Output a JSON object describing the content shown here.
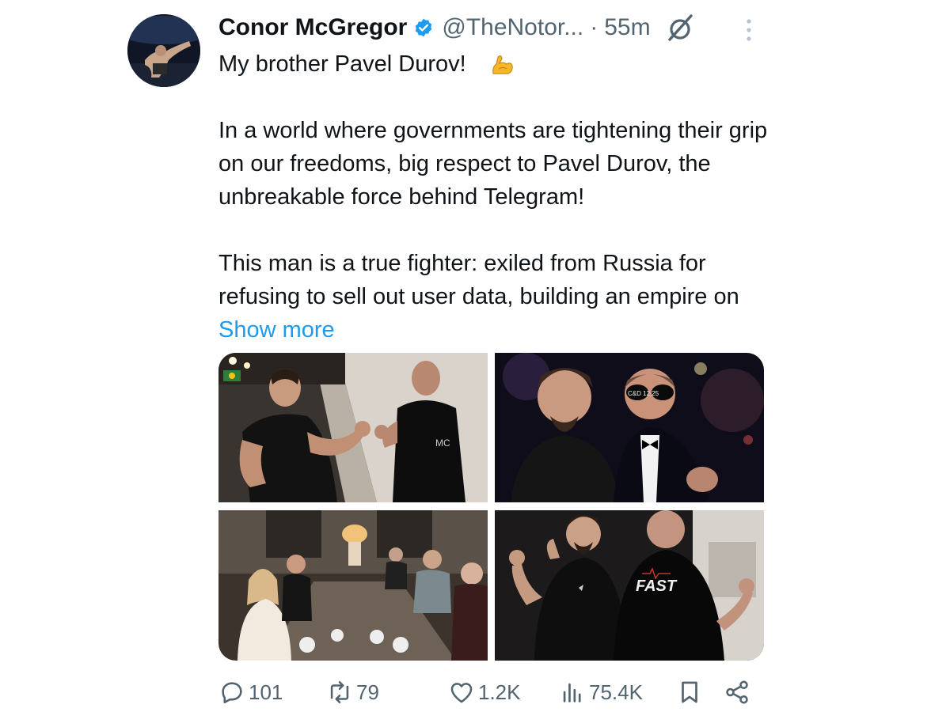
{
  "tweet": {
    "author_name": "Conor McGregor",
    "handle": "@TheNotor...",
    "separator": "·",
    "time": "55m",
    "text": "My brother Pavel Durov!\n\nIn a world where governments are tightening their grip on our freedoms, big respect to Pavel Durov, the unbreakable force behind Telegram!\n\nThis man is a true fighter: exiled from Russia for refusing to sell out user data, building an empire on",
    "show_more": "Show more",
    "emoji": "flexed-biceps-icon"
  },
  "photos": {
    "sunglasses_text": "C&D 12.25",
    "shirt_label": "MC",
    "shirt_text": "FAST"
  },
  "actions": {
    "replies": "101",
    "reposts": "79",
    "likes": "1.2K",
    "views": "75.4K"
  },
  "icons": [
    "verified-badge-icon",
    "grok-icon",
    "more-options-icon",
    "reply-icon",
    "repost-icon",
    "like-icon",
    "views-icon",
    "bookmark-icon",
    "share-icon"
  ],
  "colors": {
    "accent": "#1d9bf0",
    "muted": "#536471",
    "text": "#0f1419"
  }
}
